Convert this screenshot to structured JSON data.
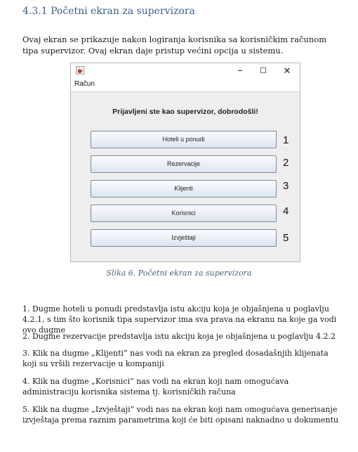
{
  "section_heading": "4.3.1 Početni ekran za supervizora",
  "intro_text": "Ovaj ekran se prikazuje nakon logiranja korisnika sa korisničkim računom tipa supervizor. Ovaj ekran daje pristup većini opcija u sistemu.",
  "window": {
    "controls": {
      "minimize": "−",
      "maximize": "☐",
      "close": "✕"
    },
    "menu": [
      "Račun"
    ],
    "welcome": "Prijavljeni ste kao supervizor, dobrodošli!",
    "buttons": [
      {
        "label": "Hoteli u ponudi",
        "number": "1"
      },
      {
        "label": "Rezervacije",
        "number": "2"
      },
      {
        "label": "Klijenti",
        "number": "3"
      },
      {
        "label": "Korisnici",
        "number": "4"
      },
      {
        "label": "Izvještaji",
        "number": "5"
      }
    ]
  },
  "caption": "Slika 6. Početni ekran za supervizora",
  "paragraphs": [
    "1. Dugme hoteli u ponudi predstavlja istu akciju koja je objašnjena u poglavlju 4.2.1, s tim što korisnik tipa supervizor ima sva prava na ekranu na koje ga vodi ovo dugme",
    "2. Dugme rezervacije predstavlja istu akciju koja je objašnjena u poglavlju 4.2.2",
    "3. Klik na dugme „Klijenti“ nas vodi na ekran za pregled dosadašnjih klijenata koji su vršili rezervacije u kompaniji",
    "4. Klik na dugme „Korisnici“ nas vodi na ekran koji nam omogućava administraciju korisnika sistema tj. korisničkih računa",
    "5. Klik na dugme „Izvještaji“ vodi nas na ekran koji nam omogućava generisanje izvještaja prema raznim parametrima koji će biti opisani naknadno u dokumentu"
  ]
}
